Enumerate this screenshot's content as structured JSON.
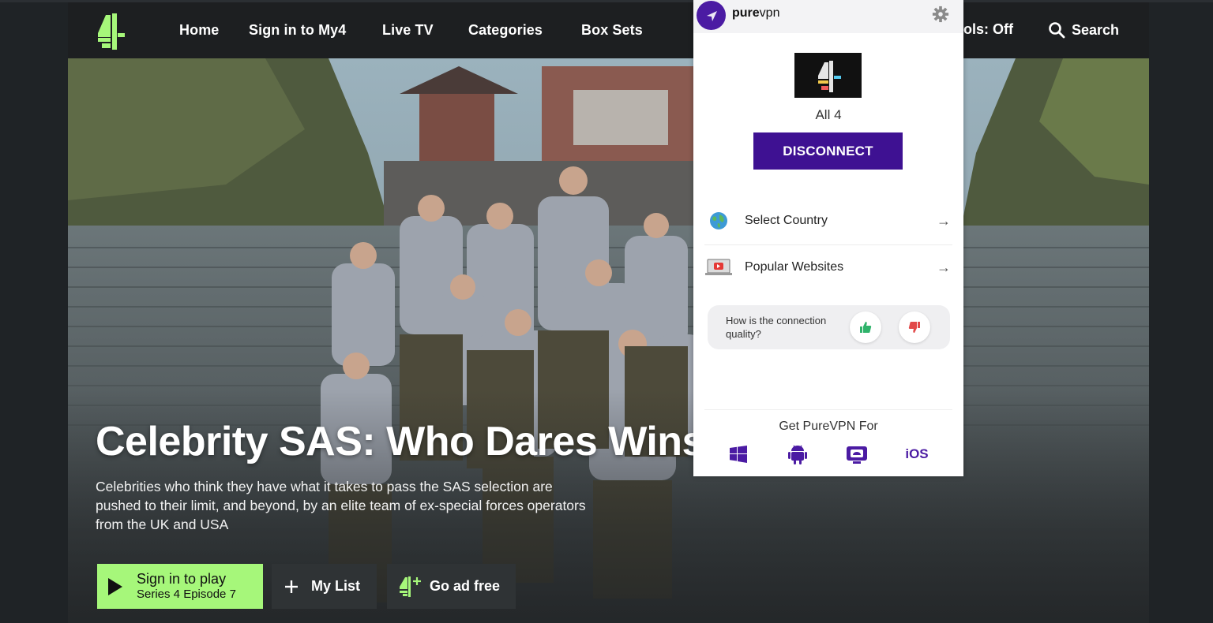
{
  "nav": {
    "home": "Home",
    "sign_in": "Sign in to My4",
    "live_tv": "Live TV",
    "categories": "Categories",
    "box_sets": "Box Sets",
    "controls_partial": "ols: Off",
    "search": "Search"
  },
  "hero": {
    "title": "Celebrity SAS: Who Dares Wins",
    "description": "Celebrities who think they have what it takes to pass the SAS selection are pushed to their limit, and beyond, by an elite team of ex-special forces operators from the UK and USA",
    "play_line1": "Sign in to play",
    "play_line2": "Series 4 Episode 7",
    "my_list": "My List",
    "ad_free": "Go ad free"
  },
  "vpn": {
    "brand_bold": "pure",
    "brand_light": "vpn",
    "site_name": "All 4",
    "disconnect": "DISCONNECT",
    "select_country": "Select Country",
    "popular_websites": "Popular Websites",
    "quality_question": "How is the connection quality?",
    "get_label": "Get PureVPN For",
    "ios": "iOS"
  },
  "colors": {
    "accent_green": "#a6f77a",
    "vpn_purple": "#3e1192",
    "navbar": "#1d1f21"
  }
}
